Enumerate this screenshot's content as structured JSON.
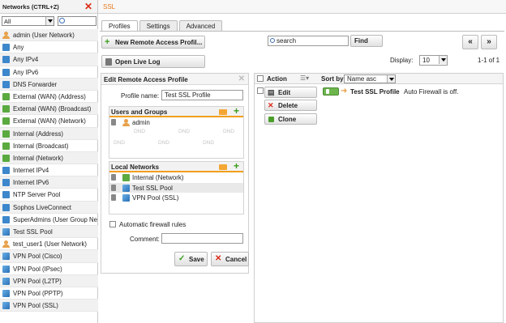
{
  "left_panel": {
    "title": "Networks (CTRL+Z)",
    "filter_value": "All",
    "items": [
      {
        "label": "admin (User Network)",
        "icon": "user"
      },
      {
        "label": "Any",
        "icon": "net"
      },
      {
        "label": "Any IPv4",
        "icon": "net"
      },
      {
        "label": "Any IPv6",
        "icon": "net"
      },
      {
        "label": "DNS Forwarder",
        "icon": "net"
      },
      {
        "label": "External (WAN) (Address)",
        "icon": "netg"
      },
      {
        "label": "External (WAN) (Broadcast)",
        "icon": "netg"
      },
      {
        "label": "External (WAN) (Network)",
        "icon": "netg"
      },
      {
        "label": "Internal (Address)",
        "icon": "netg"
      },
      {
        "label": "Internal (Broadcast)",
        "icon": "netg"
      },
      {
        "label": "Internal (Network)",
        "icon": "netg"
      },
      {
        "label": "Internet IPv4",
        "icon": "net"
      },
      {
        "label": "Internet IPv6",
        "icon": "net"
      },
      {
        "label": "NTP Server Pool",
        "icon": "net"
      },
      {
        "label": "Sophos LiveConnect",
        "icon": "net"
      },
      {
        "label": "SuperAdmins (User Group Ne",
        "icon": "net"
      },
      {
        "label": "Test SSL Pool",
        "icon": "pool"
      },
      {
        "label": "test_user1 (User Network)",
        "icon": "user"
      },
      {
        "label": "VPN Pool (Cisco)",
        "icon": "pool"
      },
      {
        "label": "VPN Pool (IPsec)",
        "icon": "pool"
      },
      {
        "label": "VPN Pool (L2TP)",
        "icon": "pool"
      },
      {
        "label": "VPN Pool (PPTP)",
        "icon": "pool"
      },
      {
        "label": "VPN Pool (SSL)",
        "icon": "pool"
      }
    ]
  },
  "header": {
    "title": "SSL"
  },
  "tabs": [
    {
      "label": "Profiles"
    },
    {
      "label": "Settings"
    },
    {
      "label": "Advanced"
    }
  ],
  "toolbar": {
    "new_profile_label": "New Remote Access Profil...",
    "open_log_label": "Open Live Log",
    "search_placeholder": "search",
    "find_label": "Find",
    "prev_label": "«",
    "next_label": "»",
    "display_label": "Display:",
    "display_value": "10",
    "page_info": "1-1 of 1"
  },
  "edit_panel": {
    "title": "Edit Remote Access Profile",
    "profile_name_label": "Profile name:",
    "profile_name_value": "Test SSL Profile",
    "users_groups_title": "Users and Groups",
    "users": [
      "admin"
    ],
    "dnd_text": "DND",
    "local_networks_title": "Local Networks",
    "networks": [
      "Internal (Network)",
      "Test SSL Pool",
      "VPN Pool (SSL)"
    ],
    "auto_firewall_label": "Automatic firewall rules",
    "comment_label": "Comment:",
    "save_label": "Save",
    "cancel_label": "Cancel"
  },
  "list": {
    "action_header": "Action",
    "sort_label": "Sort by:",
    "sort_value": "Name asc",
    "row": {
      "edit_label": "Edit",
      "delete_label": "Delete",
      "clone_label": "Clone",
      "name": "Test SSL Profile",
      "status": "Auto Firewall is off."
    }
  }
}
